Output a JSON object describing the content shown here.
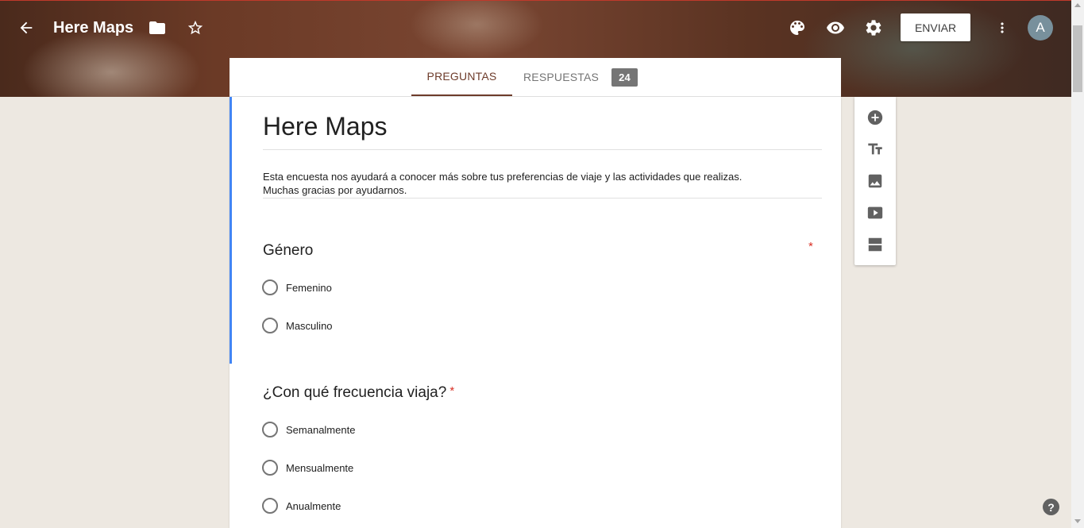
{
  "header": {
    "title": "Here Maps",
    "send_label": "ENVIAR",
    "avatar_initial": "A",
    "icons": [
      "back-arrow-icon",
      "folder-icon",
      "star-outline-icon",
      "palette-icon",
      "eye-icon",
      "gear-icon",
      "more-vert-icon"
    ]
  },
  "tabs": {
    "questions_label": "PREGUNTAS",
    "responses_label": "RESPUESTAS",
    "responses_count": "24"
  },
  "form": {
    "title": "Here Maps",
    "description_line1": "Esta encuesta nos ayudará a conocer más sobre tus preferencias de viaje y las actividades que realizas.",
    "description_line2": "Muchas gracias por ayudarnos.",
    "questions": [
      {
        "title": "Género",
        "required_mark": "*",
        "options": [
          "Femenino",
          "Masculino"
        ]
      },
      {
        "title": "¿Con qué frecuencia viaja?",
        "required_mark": "*",
        "options": [
          "Semanalmente",
          "Mensualmente",
          "Anualmente"
        ]
      }
    ]
  },
  "side_toolbar": {
    "tools": [
      "add-question-icon",
      "title-text-icon",
      "image-icon",
      "video-icon",
      "section-icon"
    ]
  },
  "help_label": "?",
  "colors": {
    "accent": "#6d3b2a",
    "active_bar": "#4285f4",
    "required": "#d93025",
    "background": "#ede8e1"
  }
}
